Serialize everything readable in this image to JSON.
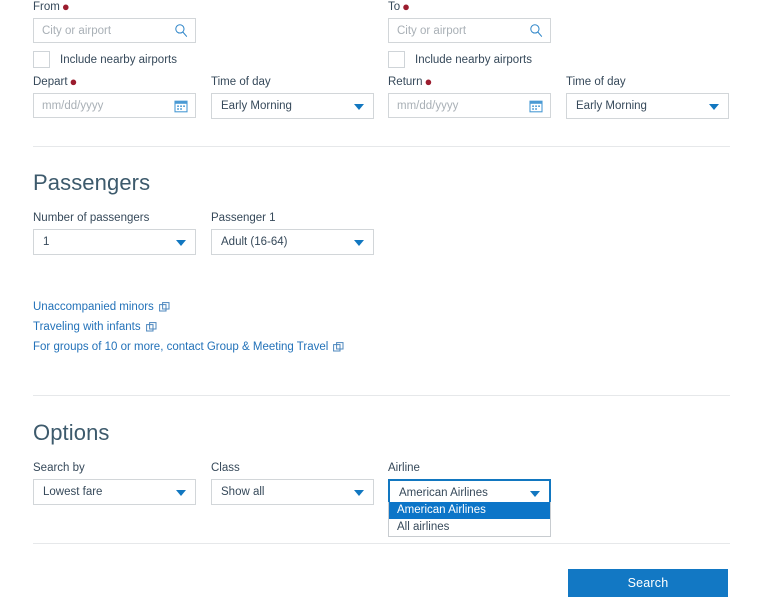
{
  "flight_search": {
    "origin": {
      "label": "From",
      "required": true,
      "placeholder": "City or airport",
      "value": "",
      "icon": "search-icon",
      "nearby": {
        "label": "Include nearby airports",
        "checked": false
      }
    },
    "destination": {
      "label": "To",
      "required": true,
      "placeholder": "City or airport",
      "value": "",
      "icon": "search-icon",
      "nearby": {
        "label": "Include nearby airports",
        "checked": false
      }
    },
    "depart": {
      "label": "Depart",
      "required": true,
      "placeholder": "mm/dd/yyyy",
      "value": "",
      "icon": "calendar-icon"
    },
    "depart_time_of_day": {
      "label": "Time of day",
      "value": "Early Morning",
      "options": [
        "Early Morning"
      ]
    },
    "return": {
      "label": "Return",
      "required": true,
      "placeholder": "mm/dd/yyyy",
      "value": "",
      "icon": "calendar-icon"
    },
    "return_time_of_day": {
      "label": "Time of day",
      "value": "Early Morning",
      "options": [
        "Early Morning"
      ]
    }
  },
  "passengers": {
    "heading": "Passengers",
    "number": {
      "label": "Number of passengers",
      "value": "1",
      "options": [
        "1"
      ]
    },
    "passenger_1": {
      "label": "Passenger 1",
      "value": "Adult (16-64)",
      "options": [
        "Adult (16-64)"
      ]
    },
    "links": [
      {
        "label": "Unaccompanied minors",
        "icon": "external-link-icon"
      },
      {
        "label": "Traveling with infants",
        "icon": "external-link-icon"
      },
      {
        "label": "For groups of 10 or more, contact Group & Meeting Travel",
        "icon": "external-link-icon"
      }
    ]
  },
  "options": {
    "heading": "Options",
    "search_by": {
      "label": "Search by",
      "value": "Lowest fare",
      "options": [
        "Lowest fare"
      ]
    },
    "class": {
      "label": "Class",
      "value": "Show all",
      "options": [
        "Show all"
      ]
    },
    "airline": {
      "label": "Airline",
      "value": "American Airlines",
      "expanded": true,
      "options": [
        {
          "label": "American Airlines",
          "selected": true
        },
        {
          "label": "All airlines",
          "selected": false
        }
      ]
    }
  },
  "actions": {
    "search_label": "Search"
  },
  "colors": {
    "accent_blue": "#1278c4",
    "link_blue": "#2372b9",
    "highlight_blue": "#0c75c8",
    "required_red": "#9b1c2e",
    "heading_slate": "#3d5a6c",
    "text": "#36495a",
    "border": "#d2d6d9"
  }
}
